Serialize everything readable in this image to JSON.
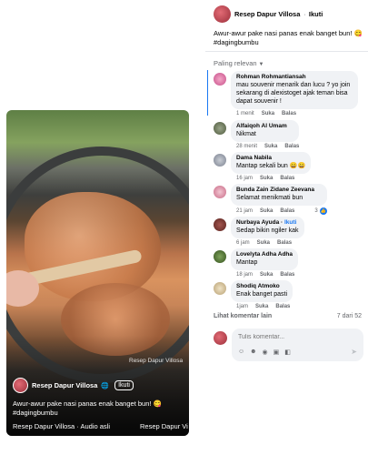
{
  "video": {
    "watermark": "Resep Dapur Villosa",
    "page_name": "Resep Dapur Villosa",
    "globe_icon": "globe-icon",
    "follow_label": "Ikuti",
    "caption": "Awur-awur pake nasi panas enak banget bun! 😋 #dagingbumbu",
    "audio_label": "Resep Dapur Villosa · Audio asli",
    "audio_right": "Resep Dapur Vi"
  },
  "post": {
    "page_name": "Resep Dapur Villosa",
    "dot": "·",
    "follow_label": "Ikuti",
    "caption": "Awur-awur pake nasi panas enak banget bun! 😋",
    "hashtag": "#dagingbumbu"
  },
  "sort": {
    "label": "Paling relevan"
  },
  "comments": [
    {
      "author": "Rohman Rohmantiansah",
      "text": "mau souvenir menarik dan lucu ? yo join sekarang di alexistoget ajak teman bisa dapat souvenir !",
      "time": "1 menit",
      "like": "Suka",
      "reply": "Balas"
    },
    {
      "author": "Alfaiqoh Al Umam",
      "text": "Nikmat",
      "time": "28 menit",
      "like": "Suka",
      "reply": "Balas"
    },
    {
      "author": "Dama Nabila",
      "text": "Mantap sekali bun 😄😄",
      "time": "16 jam",
      "like": "Suka",
      "reply": "Balas"
    },
    {
      "author": "Bunda Zain Zidane Zeevana",
      "text": "Selamat menikmati bun",
      "time": "21 jam",
      "like": "Suka",
      "reply": "Balas",
      "reactions": "3"
    },
    {
      "author": "Nurbaya Ayuda",
      "tag": "Ikuti",
      "text": "Sedap bikin ngiler kak",
      "time": "6 jam",
      "like": "Suka",
      "reply": "Balas"
    },
    {
      "author": "Lovelyta Adha Adha",
      "text": "Mantap",
      "time": "18 jam",
      "like": "Suka",
      "reply": "Balas"
    },
    {
      "author": "Shodiq Atmoko",
      "text": "Enak banget pasti",
      "time": "1jam",
      "like": "Suka",
      "reply": "Balas"
    }
  ],
  "more": {
    "label": "Lihat komentar lain",
    "count": "7 dari 52"
  },
  "compose": {
    "placeholder": "Tulis komentar..."
  },
  "colors": {
    "accent": "#1877f2",
    "bubble": "#f0f2f5",
    "meta": "#65676b"
  }
}
